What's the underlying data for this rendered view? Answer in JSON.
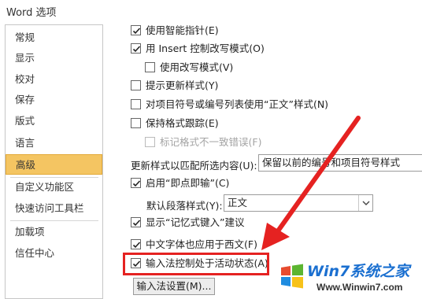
{
  "window": {
    "title": "Word 选项"
  },
  "sidebar": {
    "items": [
      {
        "label": "常规"
      },
      {
        "label": "显示"
      },
      {
        "label": "校对"
      },
      {
        "label": "保存"
      },
      {
        "label": "版式"
      },
      {
        "label": "语言"
      },
      {
        "label": "高级"
      },
      {
        "label": "自定义功能区"
      },
      {
        "label": "快速访问工具栏"
      },
      {
        "label": "加载项"
      },
      {
        "label": "信任中心"
      }
    ],
    "active": "高级"
  },
  "options": {
    "smart_pointer": {
      "label": "使用智能指针(E)",
      "checked": true
    },
    "insert_overtype": {
      "label": "用 Insert 控制改写模式(O)",
      "checked": true
    },
    "use_overtype": {
      "label": "使用改写模式(V)",
      "checked": false
    },
    "prompt_update_style": {
      "label": "提示更新样式(Y)",
      "checked": false
    },
    "normal_style_bullets": {
      "label": "对项目符号或编号列表使用“正文”样式(N)",
      "checked": false
    },
    "track_formatting": {
      "label": "保持格式跟踪(E)",
      "checked": false
    },
    "mark_inconsistency": {
      "label": "标记格式不一致错误(F)",
      "checked": false,
      "disabled": true
    },
    "update_style_label": "更新样式以匹配所选内容(U):",
    "update_style_value": "保留以前的编号和项目符号样式",
    "click_and_type": {
      "label": "启用“即点即输”(C)",
      "checked": true
    },
    "default_paragraph_label": "默认段落样式(Y):",
    "default_paragraph_value": "正文",
    "autocomplete": {
      "label": "显示“记忆式键入”建议",
      "checked": true
    },
    "latin_font": {
      "label": "中文字体也应用于西文(F)",
      "checked": true
    },
    "ime_control": {
      "label": "输入法控制处于活动状态(A)",
      "checked": true
    },
    "ime_settings_button": "输入法设置(M)..."
  },
  "watermark": {
    "brand": "Win7系统之家",
    "url": "Www.Winwin7.com"
  },
  "colors": {
    "highlight": "#e52221",
    "active_nav": "#f4c562"
  }
}
